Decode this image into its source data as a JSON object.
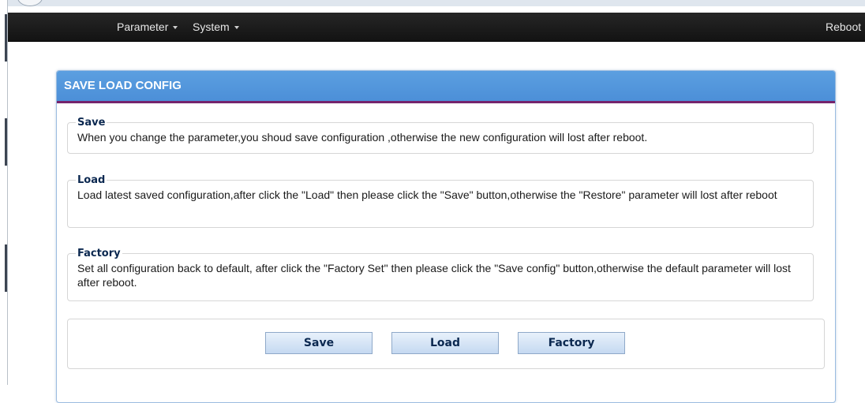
{
  "nav": {
    "items": [
      {
        "label": "Parameter"
      },
      {
        "label": "System"
      }
    ],
    "reboot_label": "Reboot"
  },
  "panel": {
    "title": "SAVE LOAD CONFIG",
    "sections": [
      {
        "legend": "Save",
        "text": "When you change the parameter,you shoud save configuration ,otherwise the new configuration will lost after reboot."
      },
      {
        "legend": "Load",
        "text": "Load latest saved configuration,after click the \"Load\" then please click the \"Save\" button,otherwise the \"Restore\" parameter will lost after reboot"
      },
      {
        "legend": "Factory",
        "text": "Set all configuration back to default, after click the \"Factory Set\" then please click the \"Save config\" button,otherwise the default parameter will lost after reboot."
      }
    ],
    "buttons": {
      "save": "Save",
      "load": "Load",
      "factory": "Factory"
    }
  },
  "colors": {
    "navbar": "#1c1c1c",
    "panel_header": "#5196dc",
    "header_accent": "#75236d",
    "button_text": "#0b2850"
  }
}
